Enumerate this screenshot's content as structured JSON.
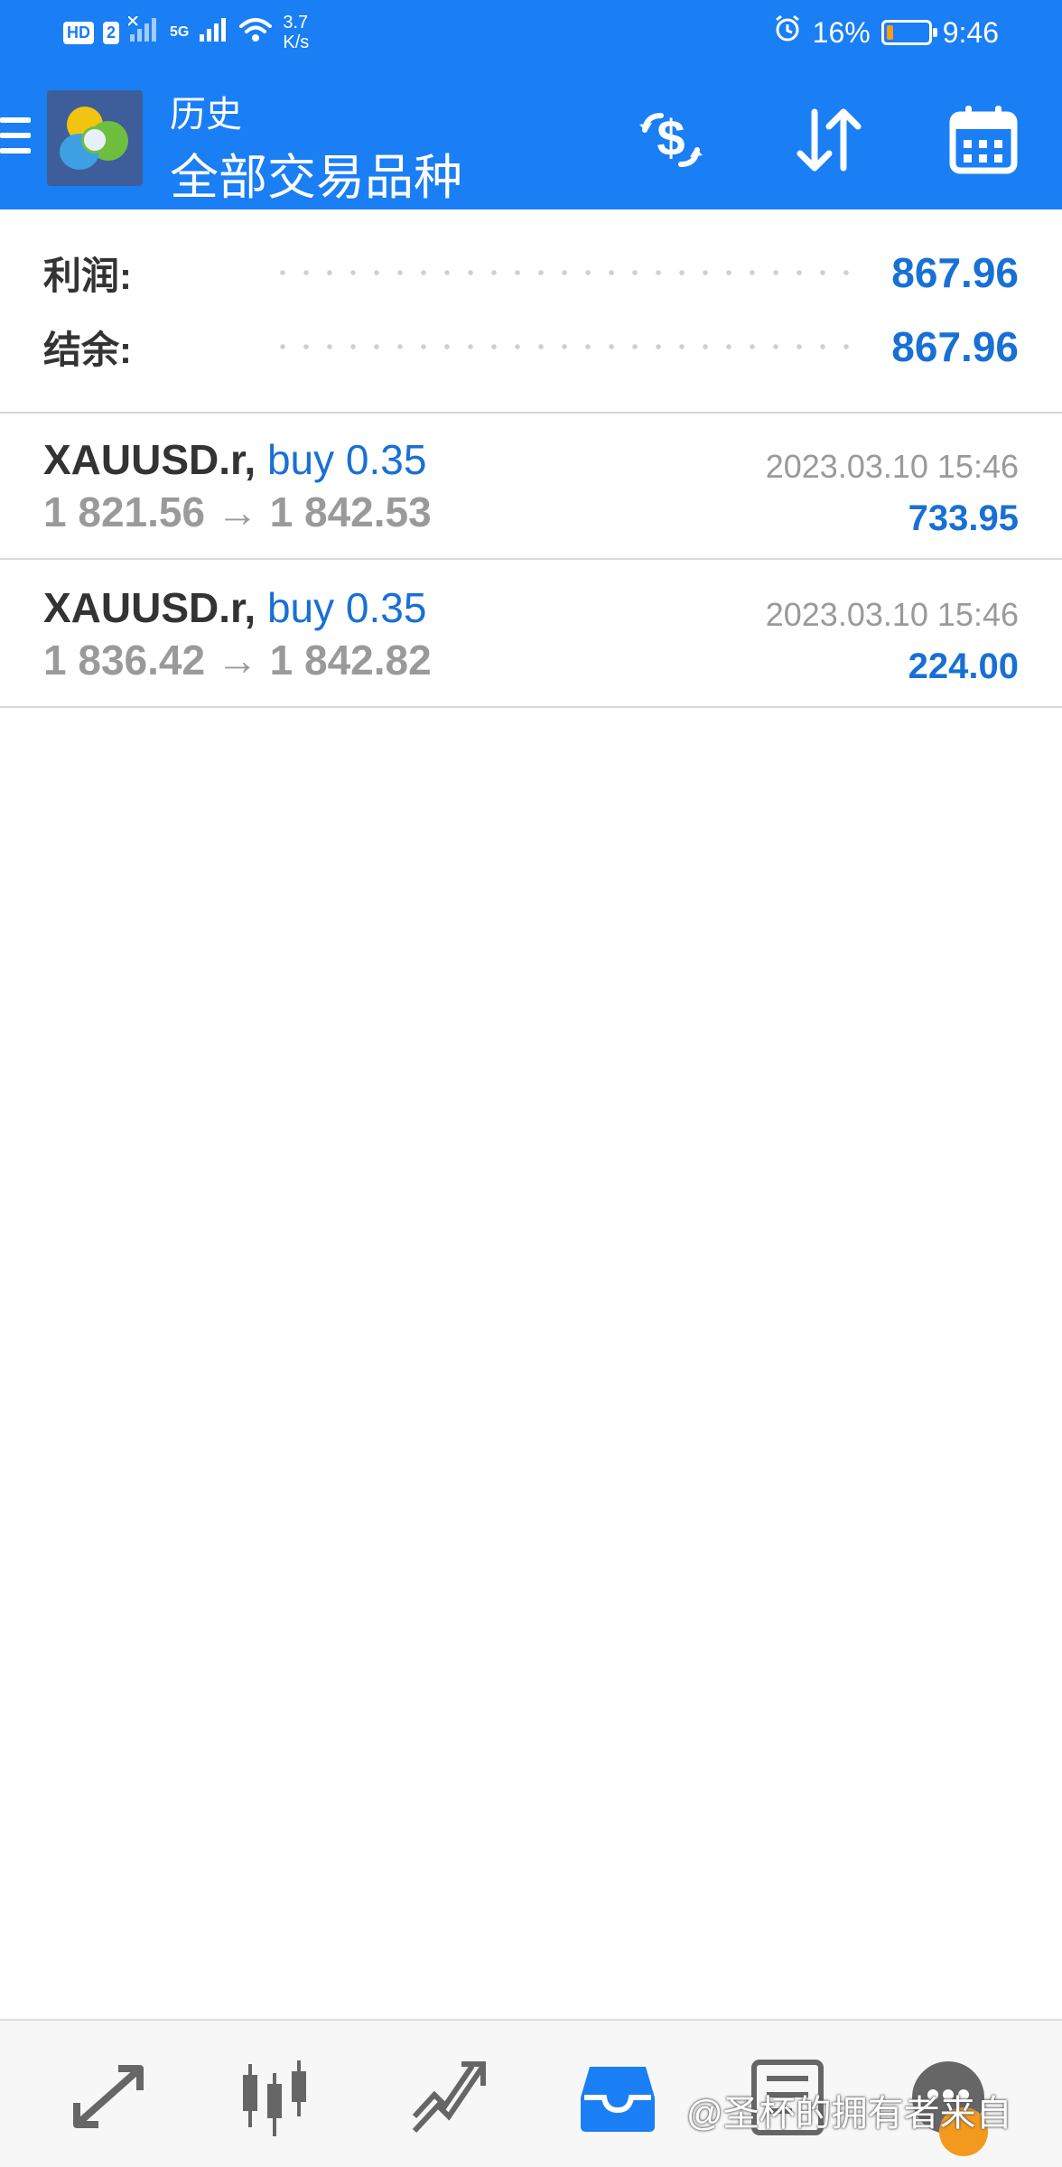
{
  "status_bar": {
    "hd_label": "HD",
    "sim_label": "2",
    "network_label": "5G",
    "speed_value": "3.7",
    "speed_unit": "K/s",
    "battery_percent": "16%",
    "battery_level": 0.16,
    "time": "9:46"
  },
  "header": {
    "title": "历史",
    "subtitle": "全部交易品种",
    "actions": [
      "currency-exchange-icon",
      "sort-icon",
      "calendar-icon"
    ]
  },
  "summary": {
    "profit_label": "利润:",
    "profit_value": "867.96",
    "balance_label": "结余:",
    "balance_value": "867.96"
  },
  "trades": [
    {
      "symbol": "XAUUSD.r",
      "side_volume": "buy 0.35",
      "prices": "1 821.56 → 1 842.53",
      "time": "2023.03.10 15:46",
      "profit": "733.95"
    },
    {
      "symbol": "XAUUSD.r",
      "side_volume": "buy 0.35",
      "prices": "1 836.42 → 1 842.82",
      "time": "2023.03.10 15:46",
      "profit": "224.00"
    }
  ],
  "bottom_nav": {
    "items": [
      "quotes-icon",
      "chart-icon",
      "trade-icon",
      "history-icon",
      "news-icon",
      "chat-icon"
    ],
    "active": "history-icon"
  },
  "watermark": "@圣杯的拥有者来自",
  "colors": {
    "accent": "#1a7ef5",
    "value_blue": "#1870d6",
    "muted": "#9a9a9a"
  }
}
